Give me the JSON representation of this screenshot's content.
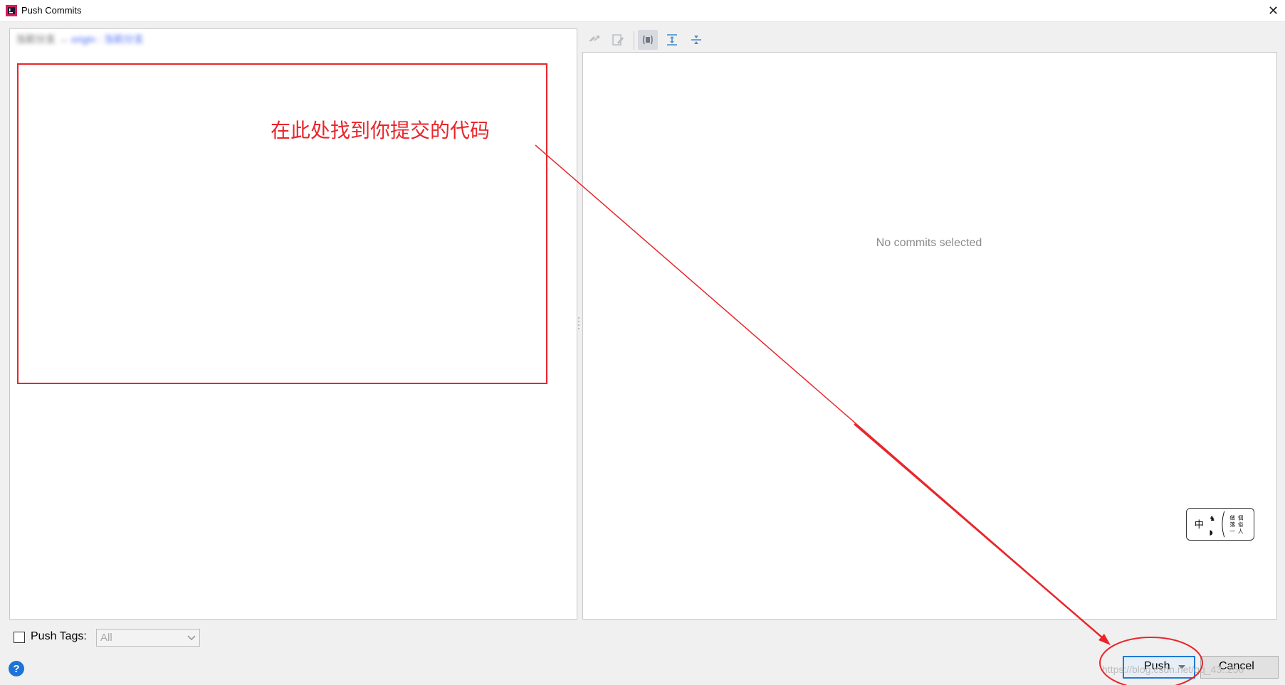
{
  "window": {
    "title": "Push Commits",
    "close_glyph": "✕"
  },
  "left": {
    "branch_local": "当前分支",
    "branch_arrow": "→",
    "branch_remote": "origin : 当前分支"
  },
  "toolbar": {
    "icons": [
      "cherry-pick-icon",
      "edit-icon",
      "group-by-icon",
      "expand-all-icon",
      "collapse-all-icon"
    ]
  },
  "right": {
    "empty_text": "No commits selected"
  },
  "bottom": {
    "push_tags_label": "Push Tags:",
    "push_tags_checked": false,
    "tags_select_value": "All",
    "help_glyph": "?",
    "push_label": "Push",
    "cancel_label": "Cancel"
  },
  "annotation": {
    "text": "在此处找到你提交的代码",
    "color": "#e8262b"
  },
  "watermark": "https://blog.csdn.net/qq_43..250",
  "colors": {
    "accent": "#1f7ad6",
    "annotation_red": "#e8262b",
    "panel_border": "#c8c8c8"
  }
}
